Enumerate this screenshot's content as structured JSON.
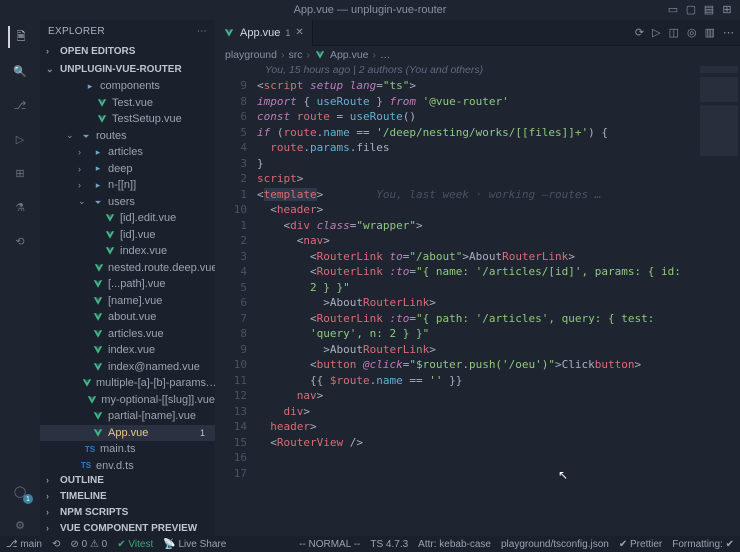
{
  "title": "App.vue — unplugin-vue-router",
  "explorer_label": "EXPLORER",
  "sections": {
    "open_editors": "OPEN EDITORS",
    "project": "UNPLUGIN-VUE-ROUTER",
    "outline": "OUTLINE",
    "timeline": "TIMELINE",
    "npm": "NPM SCRIPTS",
    "vue_preview": "VUE COMPONENT PREVIEW"
  },
  "tree": [
    {
      "indent": 30,
      "icon": "folder",
      "label": "components"
    },
    {
      "indent": 42,
      "icon": "vue",
      "label": "Test.vue"
    },
    {
      "indent": 42,
      "icon": "vue",
      "label": "TestSetup.vue"
    },
    {
      "indent": 26,
      "icon": "folder-open",
      "label": "routes",
      "chev": "⌄"
    },
    {
      "indent": 38,
      "icon": "folder",
      "label": "articles",
      "chev": "›"
    },
    {
      "indent": 38,
      "icon": "folder",
      "label": "deep",
      "chev": "›"
    },
    {
      "indent": 38,
      "icon": "folder",
      "label": "n-[[n]]",
      "chev": "›"
    },
    {
      "indent": 38,
      "icon": "folder-open",
      "label": "users",
      "chev": "⌄"
    },
    {
      "indent": 50,
      "icon": "vue",
      "label": "[id].edit.vue"
    },
    {
      "indent": 50,
      "icon": "vue",
      "label": "[id].vue"
    },
    {
      "indent": 50,
      "icon": "vue",
      "label": "index.vue"
    },
    {
      "indent": 50,
      "icon": "vue",
      "label": "nested.route.deep.vue"
    },
    {
      "indent": 38,
      "icon": "vue",
      "label": "[...path].vue"
    },
    {
      "indent": 38,
      "icon": "vue",
      "label": "[name].vue"
    },
    {
      "indent": 38,
      "icon": "vue",
      "label": "about.vue"
    },
    {
      "indent": 38,
      "icon": "vue",
      "label": "articles.vue"
    },
    {
      "indent": 38,
      "icon": "vue",
      "label": "index.vue"
    },
    {
      "indent": 38,
      "icon": "vue",
      "label": "index@named.vue"
    },
    {
      "indent": 38,
      "icon": "vue",
      "label": "multiple-[a]-[b]-params.…"
    },
    {
      "indent": 38,
      "icon": "vue",
      "label": "my-optional-[[slug]].vue"
    },
    {
      "indent": 38,
      "icon": "vue",
      "label": "partial-[name].vue"
    },
    {
      "indent": 38,
      "icon": "vue",
      "label": "App.vue",
      "active": true,
      "badge": "1"
    },
    {
      "indent": 30,
      "icon": "ts",
      "label": "main.ts"
    },
    {
      "indent": 26,
      "icon": "ts",
      "label": "env.d.ts"
    }
  ],
  "tab": {
    "label": "App.vue",
    "badge": "1"
  },
  "breadcrumb": [
    "playground",
    "src",
    "App.vue",
    "…"
  ],
  "gitlens": "You, 15 hours ago | 2 authors (You and others)",
  "code": {
    "gutter": [
      "9",
      "8",
      "",
      "6",
      "5",
      "4",
      "3",
      "2",
      "1",
      "",
      "10",
      "1",
      "2",
      "3",
      "4",
      "5",
      "6",
      "",
      "7",
      "8",
      "",
      "9",
      "10",
      "11",
      "12",
      "13",
      "14",
      "15",
      "16",
      "",
      "17"
    ],
    "inline_lens": "You, last week · working —routes …",
    "lines": {
      "l0": {
        "a": "<",
        "b": "script",
        "c": " setup lang",
        "d": "=",
        "e": "\"ts\"",
        "f": ">"
      },
      "l1": {
        "a": "import",
        "b": " { ",
        "c": "useRoute",
        "d": " } ",
        "e": "from",
        "f": " '@vue-router'"
      },
      "l3": {
        "a": "const",
        "b": " route",
        "c": " = ",
        "d": "useRoute",
        "e": "()"
      },
      "l4": {
        "a": "if",
        "b": " (",
        "c": "route",
        "d": ".",
        "e": "name",
        "f": " == ",
        "g": "'/deep/nesting/works/[[files]]+'",
        "h": ") {"
      },
      "l5": {
        "a": "  route",
        "b": ".",
        "c": "params",
        "d": ".files"
      },
      "l6": "}",
      "l7": {
        "a": "</",
        "b": "script",
        "c": ">"
      },
      "l10": {
        "a": "<",
        "b": "template",
        "c": ">"
      },
      "l11": {
        "a": "  <",
        "b": "header",
        "c": ">"
      },
      "l12": {
        "a": "    <",
        "b": "div",
        "c": " class",
        "d": "=",
        "e": "\"wrapper\"",
        "f": ">"
      },
      "l13": {
        "a": "      <",
        "b": "nav",
        "c": ">"
      },
      "l14": {
        "a": "        <",
        "b": "RouterLink",
        "c": " to",
        "d": "=",
        "e": "\"/about\"",
        "f": ">About</",
        "g": "RouterLink",
        "h": ">"
      },
      "l15": {
        "a": "        <",
        "b": "RouterLink",
        "c": " :to",
        "d": "=",
        "e": "\"{ name: '/articles/[id]', params: { id:"
      },
      "l16": {
        "a": "        2 } }\""
      },
      "l17": {
        "a": "          >About</",
        "b": "RouterLink",
        "c": ">"
      },
      "l19": {
        "a": "        <",
        "b": "RouterLink",
        "c": " :to",
        "d": "=",
        "e": "\"{ path: '/articles', query: { test:"
      },
      "l20": {
        "a": "        'query', n: 2 } }\""
      },
      "l21": {
        "a": "          >About</",
        "b": "RouterLink",
        "c": ">"
      },
      "l22": {
        "a": "        <",
        "b": "button",
        "c": " @click",
        "d": "=",
        "e": "\"$router.push('/oeu')\"",
        "f": ">Click</",
        "g": "button",
        "h": ">"
      },
      "l23": {
        "a": "        {{ ",
        "b": "$route",
        "c": ".",
        "d": "name",
        "e": " == ",
        "f": "''",
        "g": " }}"
      },
      "l24": {
        "a": "      </",
        "b": "nav",
        "c": ">"
      },
      "l25": {
        "a": "    </",
        "b": "div",
        "c": ">"
      },
      "l26": {
        "a": "  </",
        "b": "header",
        "c": ">"
      },
      "l28": {
        "a": "  <",
        "b": "RouterView",
        "c": " />"
      }
    }
  },
  "status": {
    "branch": "main",
    "errors": "0",
    "warnings": "0",
    "vitest": "Vitest",
    "liveshare": "Live Share",
    "mode": "-- NORMAL --",
    "ts": "TS 4.7.3",
    "attr": "Attr: kebab-case",
    "tsconfig": "playground/tsconfig.json",
    "prettier": "Prettier",
    "formatting": "Formatting: "
  }
}
